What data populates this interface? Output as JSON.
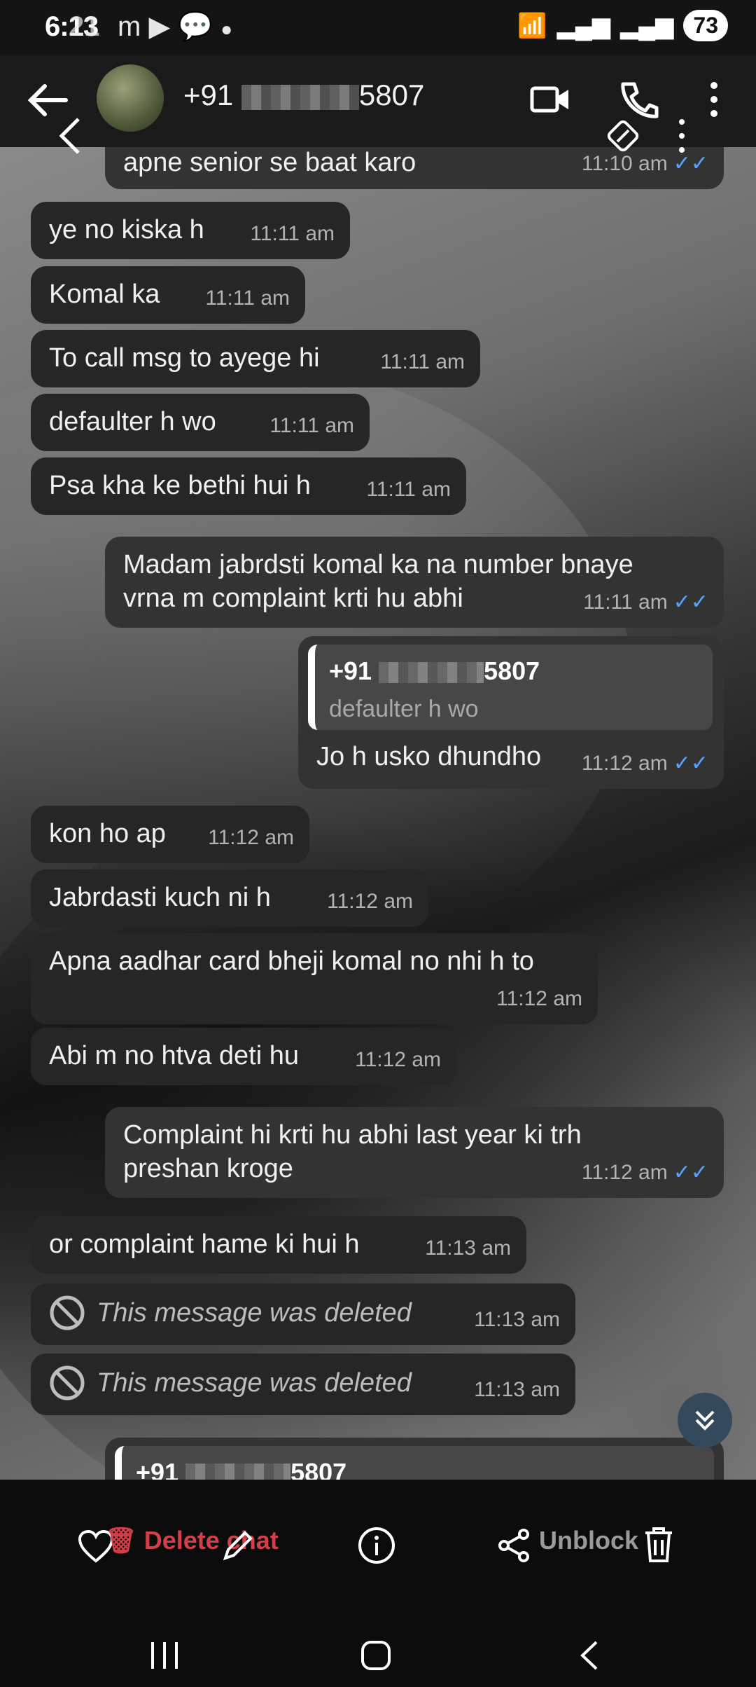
{
  "status": {
    "time": "6:13",
    "overlay_time": "21",
    "battery": "73"
  },
  "header": {
    "contact_prefix": "+91",
    "contact_suffix": "5807"
  },
  "messages": [
    {
      "text": "apne senior se baat karo",
      "time": "11:10 am",
      "dir": "out"
    },
    {
      "text": "ye no kiska h",
      "time": "11:11 am",
      "dir": "in"
    },
    {
      "text": "Komal ka",
      "time": "11:11 am",
      "dir": "in"
    },
    {
      "text": "To call msg to ayege hi",
      "time": "11:11 am",
      "dir": "in"
    },
    {
      "text": "defaulter h wo",
      "time": "11:11 am",
      "dir": "in"
    },
    {
      "text": "Psa kha ke bethi hui h",
      "time": "11:11 am",
      "dir": "in"
    },
    {
      "text_line1": "Madam jabrdsti komal ka na number bnaye",
      "text_line2": "vrna m complaint krti hu abhi",
      "time": "11:11 am",
      "dir": "out"
    },
    {
      "quote_name_prefix": "+91",
      "quote_name_suffix": "5807",
      "quote_text": "defaulter h wo",
      "text": "Jo h usko dhundho",
      "time": "11:12 am",
      "dir": "out"
    },
    {
      "text": "kon ho ap",
      "time": "11:12 am",
      "dir": "in"
    },
    {
      "text": "Jabrdasti kuch ni h",
      "time": "11:12 am",
      "dir": "in"
    },
    {
      "text": "Apna aadhar card bheji komal no nhi h to",
      "time": "11:12 am",
      "dir": "in"
    },
    {
      "text": "Abi m no htva deti hu",
      "time": "11:12 am",
      "dir": "in"
    },
    {
      "text_line1": "Complaint hi krti hu abhi last year ki trh",
      "text_line2": "preshan kroge",
      "time": "11:12 am",
      "dir": "out"
    },
    {
      "text": "or complaint hame ki hui h",
      "time": "11:13 am",
      "dir": "in"
    },
    {
      "text": "This message was deleted",
      "time": "11:13 am",
      "dir": "in"
    },
    {
      "text": "This message was deleted",
      "time": "11:13 am",
      "dir": "in"
    },
    {
      "quote_name_prefix": "+91",
      "quote_name_suffix": "5807",
      "dir": "out"
    }
  ],
  "bottom": {
    "delete_chat": "Delete chat",
    "unblock": "Unblock"
  },
  "colors": {
    "accent_blue": "#5aa2ff",
    "delete_red": "#d33f49",
    "bubble_in": "#262626",
    "bubble_out": "#333333"
  }
}
